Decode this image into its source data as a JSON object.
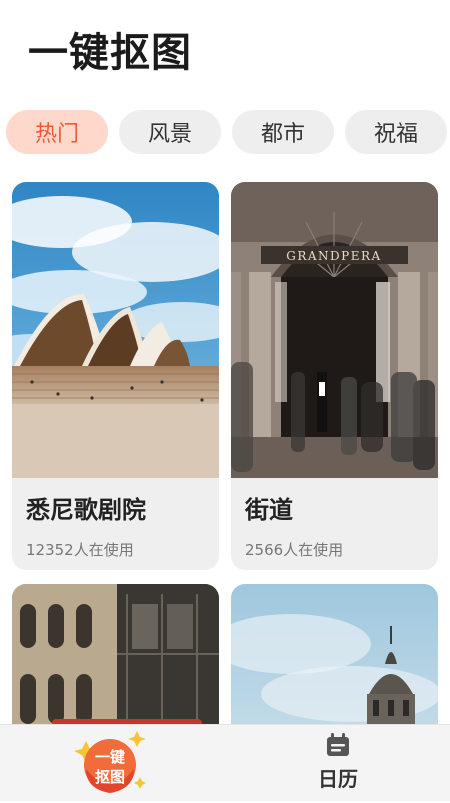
{
  "app": {
    "title": "一键抠图"
  },
  "categories": [
    {
      "label": "热门",
      "active": true
    },
    {
      "label": "风景",
      "active": false
    },
    {
      "label": "都市",
      "active": false
    },
    {
      "label": "祝福",
      "active": false
    }
  ],
  "cards": [
    {
      "name": "悉尼歌剧院",
      "usage": "12352人在使用",
      "image": "sydney-opera-house-photo"
    },
    {
      "name": "街道",
      "usage": "2566人在使用",
      "image": "grandpera-street-photo",
      "sign_text": "GRANDPERA"
    },
    {
      "name": "",
      "usage": "",
      "image": "old-building-facade-photo"
    },
    {
      "name": "",
      "usage": "",
      "image": "dome-tower-sky-photo"
    }
  ],
  "tabbar": {
    "home": {
      "badge_line1": "一键",
      "badge_line2": "抠图",
      "icon": "one-click-cutout-badge-icon"
    },
    "calendar": {
      "label": "日历",
      "icon": "calendar-icon"
    }
  },
  "colors": {
    "accent": "#ef5a35",
    "chip_active_bg": "#ffd8cc",
    "chip_bg": "#eeeeee",
    "card_bg": "#efefef"
  }
}
